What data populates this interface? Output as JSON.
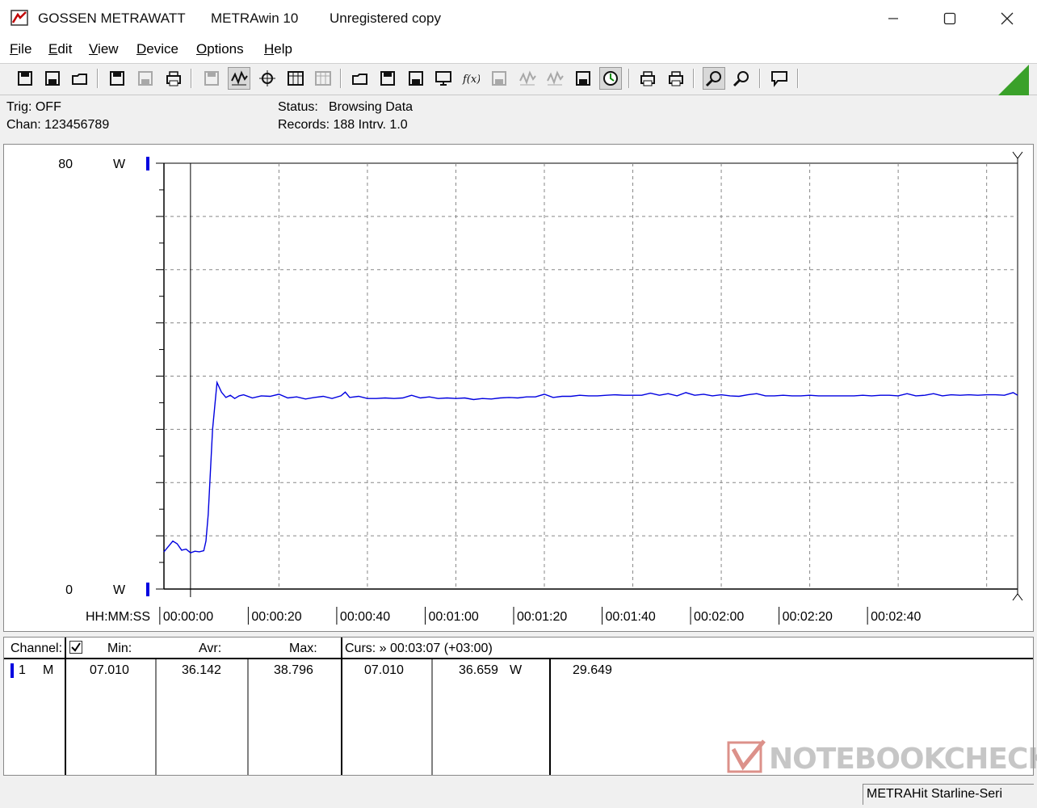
{
  "window": {
    "vendor": "GOSSEN METRAWATT",
    "app": "METRAwin 10",
    "license": "Unregistered copy"
  },
  "menu": [
    {
      "accel": "F",
      "rest": "ile"
    },
    {
      "accel": "E",
      "rest": "dit"
    },
    {
      "accel": "V",
      "rest": "iew"
    },
    {
      "accel": "D",
      "rest": "evice"
    },
    {
      "accel": "O",
      "rest": "ptions"
    },
    {
      "accel": "H",
      "rest": "elp"
    }
  ],
  "toolbar": {
    "icons": [
      "save-icon",
      "save-as-icon",
      "open-icon",
      "export-icon",
      "disabled-export-icon",
      "print-setup-icon",
      "disabled-list-icon",
      "waveform-view-icon",
      "crosshair-icon",
      "table-view-icon",
      "disabled-table-icon",
      "transfer-icon",
      "device-icon",
      "settings-grid-icon",
      "monitor-icon",
      "function-icon",
      "disabled-memory-icon",
      "disabled-wave-icon",
      "disabled-wave2-icon",
      "measure-icon",
      "clock-icon",
      "print-icon",
      "print2-icon",
      "zoom-wave-icon",
      "zoom-fit-icon",
      "message-icon"
    ]
  },
  "status": {
    "trig": "Trig: OFF",
    "chan": "Chan:  123456789",
    "status_label": "Status:",
    "status_value": "Browsing Data",
    "records": "Records: 188  Intrv. 1.0"
  },
  "chart_data": {
    "type": "line",
    "ylim": [
      0,
      80
    ],
    "y_top_label": "80",
    "y_bottom_label": "0",
    "y_unit": "W",
    "xlabel": "HH:MM:SS",
    "xlim": [
      -6,
      187
    ],
    "x_tick_labels": [
      "00:00:00",
      "00:00:20",
      "00:00:40",
      "00:01:00",
      "00:01:20",
      "00:01:40",
      "00:02:00",
      "00:02:20",
      "00:02:40"
    ],
    "series": [
      {
        "color": "#0000e0",
        "x": [
          -6,
          -5,
          -4,
          -3,
          -2,
          -1,
          0,
          1,
          2,
          3,
          3.5,
          4,
          5,
          6,
          7,
          8,
          9,
          10,
          11,
          12,
          14,
          16,
          18,
          20,
          22,
          24,
          26,
          28,
          30,
          32,
          34,
          35,
          36,
          38,
          40,
          42,
          44,
          46,
          48,
          50,
          52,
          54,
          56,
          58,
          60,
          62,
          64,
          66,
          68,
          70,
          72,
          74,
          76,
          78,
          80,
          82,
          84,
          86,
          88,
          90,
          92,
          94,
          96,
          98,
          100,
          102,
          104,
          106,
          108,
          110,
          112,
          114,
          116,
          118,
          120,
          122,
          124,
          126,
          128,
          130,
          132,
          134,
          136,
          138,
          140,
          142,
          144,
          146,
          148,
          150,
          152,
          154,
          156,
          158,
          160,
          162,
          164,
          166,
          168,
          170,
          172,
          174,
          176,
          178,
          180,
          182,
          184,
          186,
          187
        ],
        "values": [
          7.0,
          8.0,
          9.0,
          8.5,
          7.3,
          7.5,
          6.8,
          7.1,
          7.0,
          7.2,
          9.0,
          14.0,
          30.0,
          38.8,
          37.0,
          36.0,
          36.4,
          35.8,
          36.3,
          36.5,
          35.9,
          36.3,
          36.2,
          36.6,
          35.9,
          36.1,
          35.7,
          36.0,
          36.2,
          35.8,
          36.3,
          37.0,
          36.0,
          36.2,
          35.8,
          35.8,
          35.9,
          35.8,
          35.9,
          36.4,
          35.9,
          36.1,
          35.8,
          35.9,
          35.8,
          35.9,
          35.6,
          35.8,
          35.7,
          35.9,
          36.0,
          35.9,
          36.1,
          36.1,
          36.6,
          36.0,
          36.2,
          36.2,
          36.4,
          36.3,
          36.3,
          36.4,
          36.5,
          36.4,
          36.4,
          36.4,
          36.8,
          36.4,
          36.7,
          36.3,
          36.9,
          36.4,
          36.6,
          36.3,
          36.5,
          36.3,
          36.2,
          36.5,
          36.7,
          36.3,
          36.3,
          36.4,
          36.3,
          36.3,
          36.4,
          36.3,
          36.3,
          36.3,
          36.3,
          36.3,
          36.4,
          36.3,
          36.4,
          36.4,
          36.3,
          36.7,
          36.3,
          36.4,
          36.7,
          36.3,
          36.5,
          36.4,
          36.5,
          36.4,
          36.5,
          36.5,
          36.4,
          36.9,
          36.4
        ]
      }
    ]
  },
  "table": {
    "headers": {
      "channel": "Channel:",
      "min": "Min:",
      "avr": "Avr:",
      "max": "Max:",
      "curs": "Curs: » 00:03:07 (+03:00)"
    },
    "row": {
      "ch_num": "1",
      "ch_mode": "M",
      "min": "07.010",
      "avr": "36.142",
      "max": "38.796",
      "c1": "07.010",
      "c2": "36.659",
      "unit": "W",
      "c3": "29.649"
    }
  },
  "statusbar": {
    "device": "METRAHit Starline-Seri"
  },
  "watermark": "NOTEBOOKCHECK",
  "colors": {
    "series": "#0000e0",
    "grid": "#999999",
    "accent": "#3aa12a"
  }
}
